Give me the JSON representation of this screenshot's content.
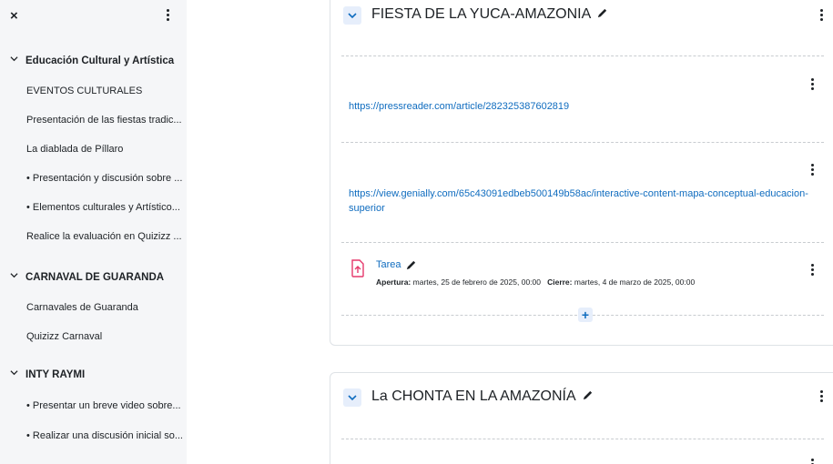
{
  "sidebar": {
    "close_glyph": "×",
    "sections": [
      {
        "title": "Educación Cultural y Artística",
        "items": [
          "EVENTOS CULTURALES",
          "Presentación de las fiestas tradic...",
          "La diablada de Píllaro",
          "• Presentación y discusión sobre ...",
          "• Elementos culturales y Artístico...",
          "Realice la evaluación en Quizizz ..."
        ]
      },
      {
        "title": "CARNAVAL DE GUARANDA",
        "items": [
          "Carnavales de Guaranda",
          "Quizizz Carnaval"
        ]
      },
      {
        "title": "INTY RAYMI",
        "items": [
          "• Presentar un breve video sobre...",
          "• Realizar una discusión inicial so..."
        ]
      }
    ]
  },
  "main": {
    "section1": {
      "title": "FIESTA DE LA YUCA-AMAZONIA",
      "link1": "https://pressreader.com/article/282325387602819",
      "link2_line1": "https://view.genially.com/65c43091edbeb500149b58ac/interactive-content-mapa-conceptual-educacion-",
      "link2_line2": "superior",
      "activity": {
        "name": "Tarea",
        "opening_label": "Apertura:",
        "opening_value": "martes, 25 de febrero de 2025, 00:00",
        "closing_label": "Cierre:",
        "closing_value": "martes, 4 de marzo de 2025, 00:00"
      },
      "add_glyph": "+"
    },
    "section2": {
      "title": "La CHONTA EN LA AMAZONÍA"
    }
  },
  "colors": {
    "link": "#0f6cbf",
    "sidebar_bg": "#f5f6f8",
    "toggle_bg": "#e6eefb",
    "assign_icon": "#e5386b"
  }
}
